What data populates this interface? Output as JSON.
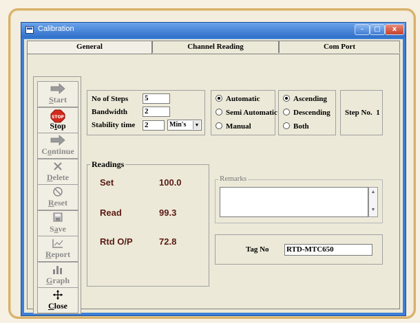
{
  "window": {
    "title": "Calibration",
    "min": "–",
    "max": "□",
    "close": "x"
  },
  "tabs": [
    "General",
    "Channel Reading",
    "Com Port"
  ],
  "toolbar": [
    {
      "pre": "",
      "u": "S",
      "post": "tart",
      "icon": "arrow-right-icon",
      "disabled": true
    },
    {
      "pre": "S",
      "u": "t",
      "post": "op",
      "icon": "stop-sign-icon",
      "icon_text": "STOP",
      "disabled": false
    },
    {
      "pre": "C",
      "u": "o",
      "post": "ntinue",
      "icon": "arrow-right-icon",
      "disabled": true
    },
    {
      "pre": "",
      "u": "D",
      "post": "elete",
      "icon": "x-icon",
      "disabled": true
    },
    {
      "pre": "",
      "u": "R",
      "post": "eset",
      "icon": "reset-icon",
      "disabled": true
    },
    {
      "pre": "S",
      "u": "a",
      "post": "ve",
      "icon": "floppy-icon",
      "disabled": true
    },
    {
      "pre": "",
      "u": "R",
      "post": "eport",
      "icon": "report-icon",
      "disabled": true
    },
    {
      "pre": "",
      "u": "G",
      "post": "raph",
      "icon": "bar-graph-icon",
      "disabled": true
    },
    {
      "pre": "",
      "u": "C",
      "post": "lose",
      "icon": "move-arrows-icon",
      "disabled": false
    }
  ],
  "settings": {
    "steps_label": "No of Steps",
    "steps_value": "5",
    "bandwidth_label": "Bandwidth",
    "bandwidth_value": "2",
    "stability_label": "Stability time",
    "stability_value": "2",
    "unit_value": "Min's"
  },
  "mode": {
    "options": [
      "Automatic",
      "Semi Automatic",
      "Manual"
    ],
    "selected": 0
  },
  "order": {
    "options": [
      "Ascending",
      "Descending",
      "Both"
    ],
    "selected": 0
  },
  "step": {
    "label": "Step No.",
    "value": "1"
  },
  "readings": {
    "title": "Readings",
    "rows": [
      {
        "label": "Set",
        "value": "100.0"
      },
      {
        "label": "Read",
        "value": "99.3"
      },
      {
        "label": "Rtd O/P",
        "value": "72.8"
      }
    ]
  },
  "remarks": {
    "title": "Remarks",
    "value": ""
  },
  "tag": {
    "label": "Tag No",
    "value": "RTD-MTC650"
  },
  "colors": {
    "accent": "#3c7fd6",
    "frame": "#d9b16a",
    "reading_text": "#5b1a14"
  }
}
